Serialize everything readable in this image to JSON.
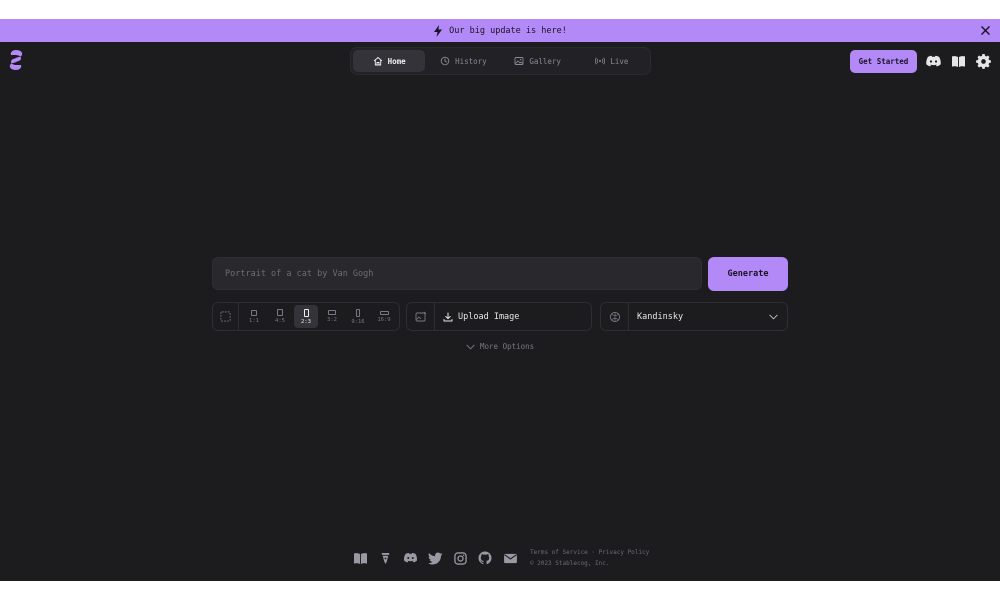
{
  "banner": {
    "text": "Our big update is here!"
  },
  "nav": {
    "tabs": [
      {
        "label": "Home",
        "icon": "home-icon",
        "active": true
      },
      {
        "label": "History",
        "icon": "history-icon",
        "active": false
      },
      {
        "label": "Gallery",
        "icon": "gallery-icon",
        "active": false
      },
      {
        "label": "Live",
        "icon": "live-icon",
        "active": false
      }
    ],
    "get_started": "Get Started"
  },
  "prompt": {
    "placeholder": "Portrait of a cat by Van Gogh",
    "value": ""
  },
  "generate_label": "Generate",
  "aspect_ratios": [
    {
      "label": "1:1",
      "active": false
    },
    {
      "label": "4:5",
      "active": false
    },
    {
      "label": "2:3",
      "active": true
    },
    {
      "label": "3:2",
      "active": false
    },
    {
      "label": "9:16",
      "active": false
    },
    {
      "label": "16:9",
      "active": false
    }
  ],
  "upload_label": "Upload Image",
  "model": {
    "selected": "Kandinsky"
  },
  "more_options": "More Options",
  "footer": {
    "terms": "Terms of Service",
    "separator": "·",
    "privacy": "Privacy Policy",
    "copyright": "© 2023 Stablecog, Inc."
  },
  "colors": {
    "accent": "#b389f7",
    "background": "#1c1b1e",
    "surface": "#29282d"
  }
}
